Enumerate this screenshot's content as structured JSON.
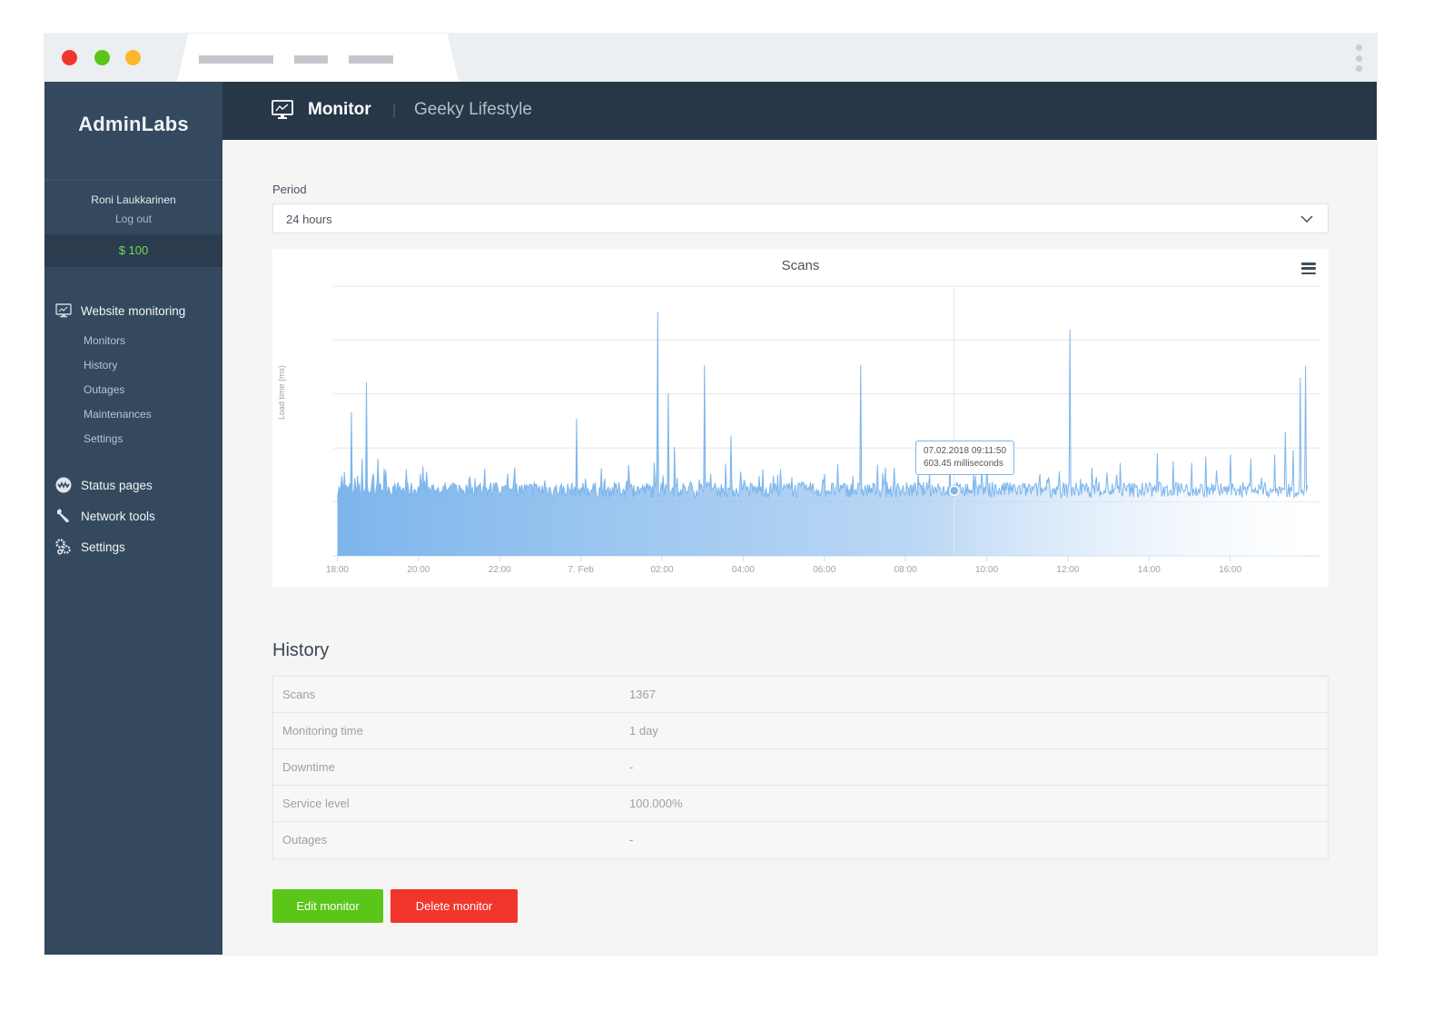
{
  "browser": {
    "tab_placeholder_bars": 3,
    "window_controls": [
      "close",
      "minimize",
      "maximize"
    ]
  },
  "sidebar": {
    "logo": "AdminLabs",
    "user": {
      "name": "Roni Laukkarinen",
      "logout_label": "Log out"
    },
    "balance": "$ 100",
    "sections": [
      {
        "label": "Website monitoring",
        "icon": "monitor-chart-icon",
        "items": [
          {
            "label": "Monitors"
          },
          {
            "label": "History"
          },
          {
            "label": "Outages"
          },
          {
            "label": "Maintenances"
          },
          {
            "label": "Settings"
          }
        ]
      },
      {
        "label": "Status pages",
        "icon": "status-wave-icon"
      },
      {
        "label": "Network tools",
        "icon": "wrench-icon"
      },
      {
        "label": "Settings",
        "icon": "gears-icon"
      }
    ]
  },
  "header": {
    "icon": "monitor-chart-icon",
    "title": "Monitor",
    "subtitle": "Geeky Lifestyle"
  },
  "period": {
    "label": "Period",
    "selected": "24 hours"
  },
  "chart_data": {
    "type": "area",
    "title": "Scans",
    "xlabel": "",
    "ylabel": "Load time (ms)",
    "x_tick_labels": [
      "18:00",
      "20:00",
      "22:00",
      "7. Feb",
      "02:00",
      "04:00",
      "06:00",
      "08:00",
      "10:00",
      "12:00",
      "14:00",
      "16:00"
    ],
    "x_range_hours": [
      -0.1,
      24.2
    ],
    "ylim": [
      0,
      2500
    ],
    "y_gridlines": [
      0,
      500,
      1000,
      1500,
      2000,
      2500
    ],
    "y_tick_labels_visible": false,
    "grid": true,
    "legend": "none",
    "color": "#7cb5ec",
    "baseline_ms": 600,
    "noise_ms": 90,
    "spikes": [
      {
        "hour": 0.1,
        "value": 740
      },
      {
        "hour": 0.35,
        "value": 1330
      },
      {
        "hour": 0.6,
        "value": 900
      },
      {
        "hour": 0.72,
        "value": 1610
      },
      {
        "hour": 1.0,
        "value": 900
      },
      {
        "hour": 1.15,
        "value": 810
      },
      {
        "hour": 1.27,
        "value": 640
      },
      {
        "hour": 1.7,
        "value": 800
      },
      {
        "hour": 2.2,
        "value": 780
      },
      {
        "hour": 3.4,
        "value": 720
      },
      {
        "hour": 4.2,
        "value": 760
      },
      {
        "hour": 5.1,
        "value": 700
      },
      {
        "hour": 5.9,
        "value": 1270
      },
      {
        "hour": 6.5,
        "value": 810
      },
      {
        "hour": 7.2,
        "value": 700
      },
      {
        "hour": 7.9,
        "value": 2260
      },
      {
        "hour": 8.15,
        "value": 1510
      },
      {
        "hour": 8.3,
        "value": 1010
      },
      {
        "hour": 9.05,
        "value": 1770
      },
      {
        "hour": 9.2,
        "value": 760
      },
      {
        "hour": 9.7,
        "value": 1110
      },
      {
        "hour": 10.4,
        "value": 740
      },
      {
        "hour": 11.2,
        "value": 730
      },
      {
        "hour": 12.0,
        "value": 760
      },
      {
        "hour": 12.9,
        "value": 1770
      },
      {
        "hour": 13.5,
        "value": 820
      },
      {
        "hour": 14.6,
        "value": 760
      },
      {
        "hour": 15.1,
        "value": 900
      },
      {
        "hour": 16.0,
        "value": 800
      },
      {
        "hour": 16.5,
        "value": 680
      },
      {
        "hour": 17.3,
        "value": 760
      },
      {
        "hour": 18.06,
        "value": 2100
      },
      {
        "hour": 18.6,
        "value": 820
      },
      {
        "hour": 19.3,
        "value": 860
      },
      {
        "hour": 20.2,
        "value": 950
      },
      {
        "hour": 20.6,
        "value": 880
      },
      {
        "hour": 21.4,
        "value": 920
      },
      {
        "hour": 22.0,
        "value": 940
      },
      {
        "hour": 22.5,
        "value": 900
      },
      {
        "hour": 23.1,
        "value": 940
      },
      {
        "hour": 23.35,
        "value": 1150
      },
      {
        "hour": 23.55,
        "value": 980
      },
      {
        "hour": 23.72,
        "value": 1650
      },
      {
        "hour": 23.85,
        "value": 1760
      }
    ],
    "tooltip": {
      "hour": 15.2,
      "timestamp": "07.02.2018 09:11:50",
      "value_text": "603.45 milliseconds",
      "value": 603.45
    }
  },
  "history": {
    "title": "History",
    "rows": [
      {
        "key": "Scans",
        "value": "1367"
      },
      {
        "key": "Monitoring time",
        "value": "1 day"
      },
      {
        "key": "Downtime",
        "value": "-"
      },
      {
        "key": "Service level",
        "value": "100.000%"
      },
      {
        "key": "Outages",
        "value": "-"
      }
    ]
  },
  "actions": {
    "edit_label": "Edit monitor",
    "delete_label": "Delete monitor",
    "edit_color": "#5ac619",
    "delete_color": "#f2352b"
  }
}
